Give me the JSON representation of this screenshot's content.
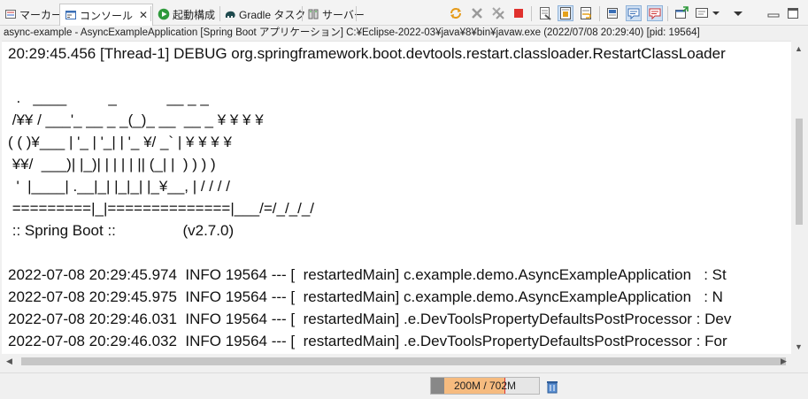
{
  "tabs": [
    {
      "label": "マーカー",
      "icon": "markers-icon"
    },
    {
      "label": "コンソール",
      "icon": "console-icon",
      "active": true,
      "close": "✕"
    },
    {
      "label": "起動構成",
      "icon": "run-icon"
    },
    {
      "label": "Gradle タスク",
      "icon": "gradle-elephant-icon"
    },
    {
      "label": "サーバー",
      "icon": "servers-icon"
    }
  ],
  "toolbar": [
    "sync-icon",
    "remove-launch-icon",
    "remove-all-icon",
    "terminate-icon",
    "clear-console-icon",
    "scroll-lock-icon",
    "word-wrap-icon",
    "pin-console-icon",
    "show-stdout-icon",
    "show-stderr-icon",
    "open-console-icon",
    "display-console-icon",
    "chevron-down-icon",
    "minimize-icon",
    "maximize-icon"
  ],
  "console": {
    "title": "async-example - AsyncExampleApplication [Spring Boot アプリケーション] C:¥Eclipse-2022-03¥java¥8¥bin¥javaw.exe  (2022/07/08 20:29:40) [pid: 19564]",
    "lines": [
      "20:29:45.456 [Thread-1] DEBUG org.springframework.boot.devtools.restart.classloader.RestartClassLoader",
      "",
      "  .   ____          _            __ _ _",
      " /¥¥ / ___'_ __ _ _(_)_ __  __ _ ¥ ¥ ¥ ¥",
      "( ( )¥___ | '_ | '_| | '_ ¥/ _` | ¥ ¥ ¥ ¥",
      " ¥¥/  ___)| |_)| | | | | || (_| |  ) ) ) )",
      "  '  |____| .__|_| |_|_| |_¥__, | / / / /",
      " =========|_|==============|___/=/_/_/_/",
      " :: Spring Boot ::                (v2.7.0)",
      "",
      "2022-07-08 20:29:45.974  INFO 19564 --- [  restartedMain] c.example.demo.AsyncExampleApplication   : St",
      "2022-07-08 20:29:45.975  INFO 19564 --- [  restartedMain] c.example.demo.AsyncExampleApplication   : N",
      "2022-07-08 20:29:46.031  INFO 19564 --- [  restartedMain] .e.DevToolsPropertyDefaultsPostProcessor : Dev",
      "2022-07-08 20:29:46.032  INFO 19564 --- [  restartedMain] .e.DevToolsPropertyDefaultsPostProcessor : For"
    ]
  },
  "status": {
    "heap_label": "200M / 702M",
    "heap_used_fraction": 0.28,
    "heap_committed_fraction": 0.68,
    "gc_icon": "trash-icon"
  }
}
